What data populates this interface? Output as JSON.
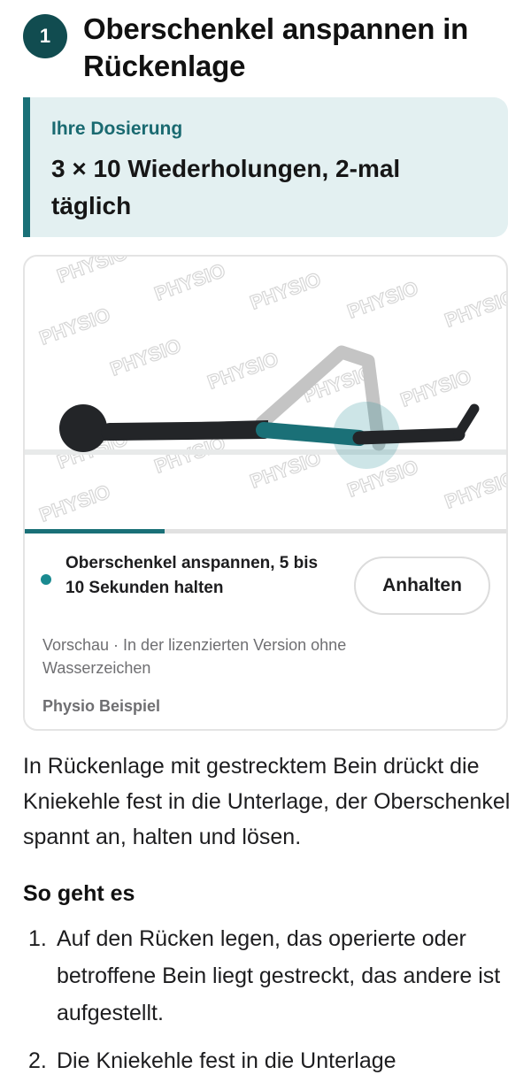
{
  "exercise": {
    "step_number": "1",
    "title": "Oberschenkel anspannen in Rückenlage"
  },
  "dosage": {
    "label": "Ihre Dosierung",
    "value": "3 × 10 Wiederholungen, 2-mal täglich"
  },
  "player": {
    "watermark_text": "PHYSIO",
    "progress_fraction": 0.29,
    "cue_text": "Oberschenkel anspannen, 5 bis 10 Sekunden halten",
    "stop_label": "Anhalten",
    "preview_note": "Vorschau · In der lizenzierten Version ohne Wasserzeichen",
    "brand": "Physio Beispiel",
    "colors": {
      "accent": "#1a7077",
      "figure": "#232528",
      "highlight": "#1a8a90",
      "ghost_leg": "#c8c8c8"
    }
  },
  "description": "In Rückenlage mit gestrecktem Bein drückt die Kniekehle fest in die Unterlage, der Oberschenkel spannt an, halten und lösen.",
  "how_to": {
    "heading": "So geht es",
    "steps": [
      {
        "number": "1.",
        "text": "Auf den Rücken legen, das operierte oder betroffene Bein liegt gestreckt, das andere ist aufgestellt."
      },
      {
        "number": "2.",
        "text": "Die Kniekehle fest in die Unterlage"
      }
    ]
  }
}
